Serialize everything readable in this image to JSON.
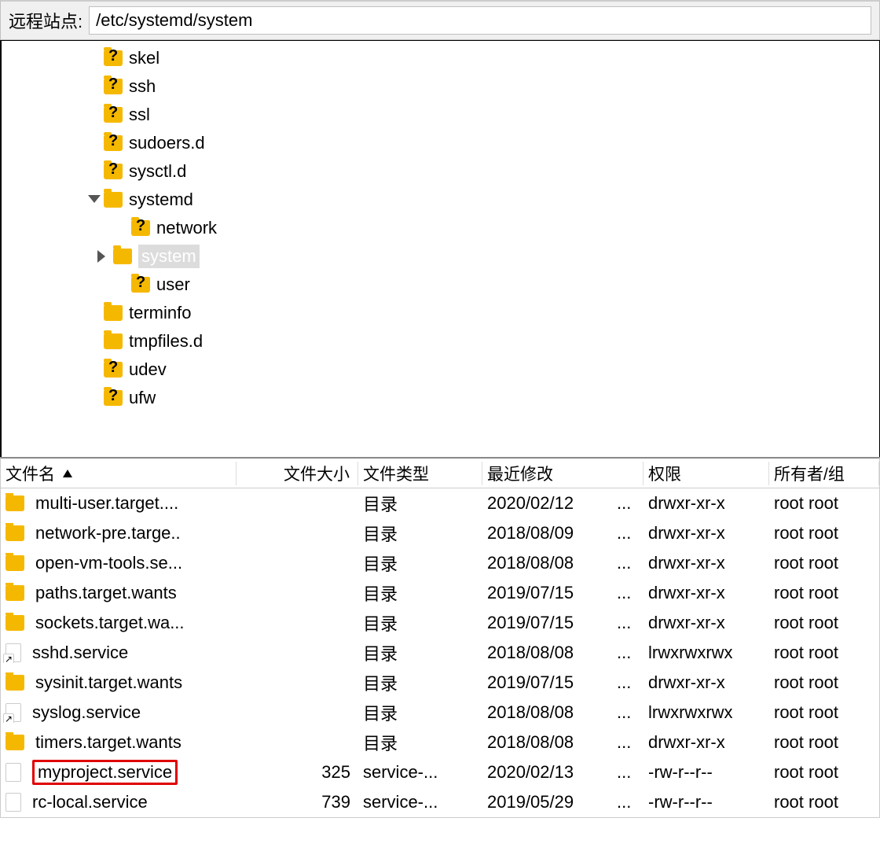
{
  "pathbar": {
    "label": "远程站点:",
    "value": "/etc/systemd/system"
  },
  "tree": [
    {
      "indent": 130,
      "expander": "",
      "icon": "folder-q",
      "label": "skel"
    },
    {
      "indent": 130,
      "expander": "",
      "icon": "folder-q",
      "label": "ssh"
    },
    {
      "indent": 130,
      "expander": "",
      "icon": "folder-q",
      "label": "ssl"
    },
    {
      "indent": 130,
      "expander": "",
      "icon": "folder-q",
      "label": "sudoers.d"
    },
    {
      "indent": 130,
      "expander": "",
      "icon": "folder-q",
      "label": "sysctl.d"
    },
    {
      "indent": 110,
      "expander": "down",
      "icon": "folder",
      "label": "systemd"
    },
    {
      "indent": 165,
      "expander": "",
      "icon": "folder-q",
      "label": "network"
    },
    {
      "indent": 122,
      "expander": "right",
      "icon": "folder",
      "label": "system",
      "selected": true
    },
    {
      "indent": 165,
      "expander": "",
      "icon": "folder-q",
      "label": "user"
    },
    {
      "indent": 130,
      "expander": "",
      "icon": "folder",
      "label": "terminfo"
    },
    {
      "indent": 130,
      "expander": "",
      "icon": "folder",
      "label": "tmpfiles.d"
    },
    {
      "indent": 130,
      "expander": "",
      "icon": "folder-q",
      "label": "udev"
    },
    {
      "indent": 130,
      "expander": "",
      "icon": "folder-q",
      "label": "ufw"
    }
  ],
  "columns": {
    "name": "文件名",
    "size": "文件大小",
    "type": "文件类型",
    "date": "最近修改",
    "perm": "权限",
    "owner": "所有者/组"
  },
  "rows": [
    {
      "icon": "folder",
      "name": "multi-user.target....",
      "size": "",
      "type": "目录",
      "date": "2020/02/12",
      "dots": "...",
      "perm": "drwxr-xr-x",
      "owner": "root root"
    },
    {
      "icon": "folder",
      "name": "network-pre.targe..",
      "size": "",
      "type": "目录",
      "date": "2018/08/09",
      "dots": "...",
      "perm": "drwxr-xr-x",
      "owner": "root root"
    },
    {
      "icon": "folder",
      "name": "open-vm-tools.se...",
      "size": "",
      "type": "目录",
      "date": "2018/08/08",
      "dots": "...",
      "perm": "drwxr-xr-x",
      "owner": "root root"
    },
    {
      "icon": "folder",
      "name": "paths.target.wants",
      "size": "",
      "type": "目录",
      "date": "2019/07/15",
      "dots": "...",
      "perm": "drwxr-xr-x",
      "owner": "root root"
    },
    {
      "icon": "folder",
      "name": "sockets.target.wa...",
      "size": "",
      "type": "目录",
      "date": "2019/07/15",
      "dots": "...",
      "perm": "drwxr-xr-x",
      "owner": "root root"
    },
    {
      "icon": "file-link",
      "name": "sshd.service",
      "size": "",
      "type": "目录",
      "date": "2018/08/08",
      "dots": "...",
      "perm": "lrwxrwxrwx",
      "owner": "root root"
    },
    {
      "icon": "folder",
      "name": "sysinit.target.wants",
      "size": "",
      "type": "目录",
      "date": "2019/07/15",
      "dots": "...",
      "perm": "drwxr-xr-x",
      "owner": "root root"
    },
    {
      "icon": "file-link",
      "name": "syslog.service",
      "size": "",
      "type": "目录",
      "date": "2018/08/08",
      "dots": "...",
      "perm": "lrwxrwxrwx",
      "owner": "root root"
    },
    {
      "icon": "folder",
      "name": "timers.target.wants",
      "size": "",
      "type": "目录",
      "date": "2018/08/08",
      "dots": "...",
      "perm": "drwxr-xr-x",
      "owner": "root root"
    },
    {
      "icon": "file",
      "name": "myproject.service",
      "size": "325",
      "type": "service-...",
      "date": "2020/02/13",
      "dots": "...",
      "perm": "-rw-r--r--",
      "owner": "root root",
      "highlight": true
    },
    {
      "icon": "file",
      "name": "rc-local.service",
      "size": "739",
      "type": "service-...",
      "date": "2019/05/29",
      "dots": "...",
      "perm": "-rw-r--r--",
      "owner": "root root"
    }
  ]
}
